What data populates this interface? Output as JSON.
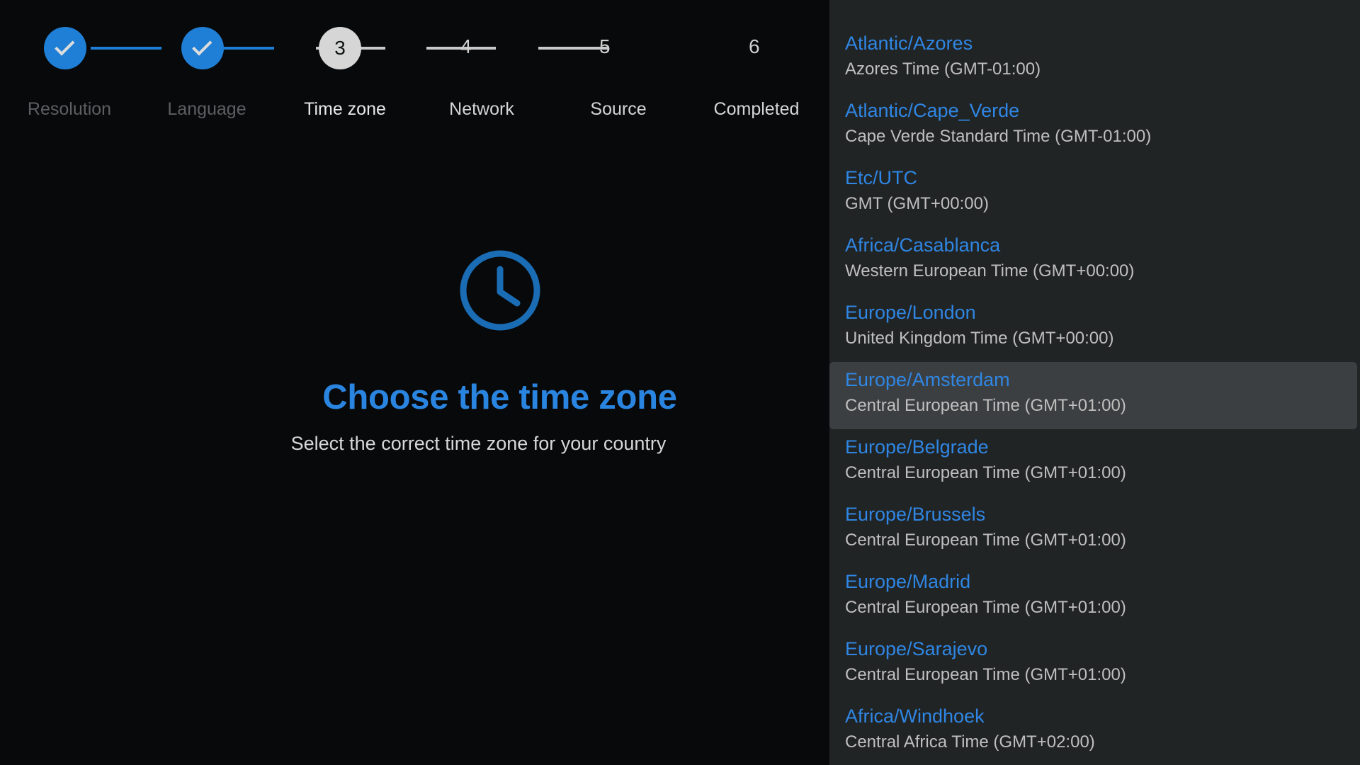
{
  "stepper": {
    "steps": [
      {
        "label": "Resolution",
        "state": "done",
        "marker": "check"
      },
      {
        "label": "Language",
        "state": "done",
        "marker": "check"
      },
      {
        "label": "Time zone",
        "state": "current",
        "marker": "3"
      },
      {
        "label": "Network",
        "state": "pending",
        "marker": "4"
      },
      {
        "label": "Source",
        "state": "pending",
        "marker": "5"
      },
      {
        "label": "Completed",
        "state": "pending",
        "marker": "6"
      }
    ]
  },
  "main": {
    "icon": "clock-icon",
    "title": "Choose the time zone",
    "subtitle": "Select the correct time zone for your country"
  },
  "colors": {
    "accent_blue": "#1f7fd6",
    "title_blue": "#2a85e0",
    "link_blue": "#2f86e3",
    "background": "#08090a",
    "panel_background": "#212425",
    "selected_row": "#3c3f41",
    "current_step_bubble": "#d6d6d6",
    "pending_connector": "#c9c9c9"
  },
  "timezone_list": {
    "selected_index": 5,
    "items": [
      {
        "name": "Atlantic/Azores",
        "description": "Azores Time (GMT-01:00)"
      },
      {
        "name": "Atlantic/Cape_Verde",
        "description": "Cape Verde Standard Time (GMT-01:00)"
      },
      {
        "name": "Etc/UTC",
        "description": "GMT (GMT+00:00)"
      },
      {
        "name": "Africa/Casablanca",
        "description": "Western European Time (GMT+00:00)"
      },
      {
        "name": "Europe/London",
        "description": "United Kingdom Time (GMT+00:00)"
      },
      {
        "name": "Europe/Amsterdam",
        "description": "Central European Time (GMT+01:00)"
      },
      {
        "name": "Europe/Belgrade",
        "description": "Central European Time (GMT+01:00)"
      },
      {
        "name": "Europe/Brussels",
        "description": "Central European Time (GMT+01:00)"
      },
      {
        "name": "Europe/Madrid",
        "description": "Central European Time (GMT+01:00)"
      },
      {
        "name": "Europe/Sarajevo",
        "description": "Central European Time (GMT+01:00)"
      },
      {
        "name": "Africa/Windhoek",
        "description": "Central Africa Time (GMT+02:00)"
      }
    ]
  }
}
